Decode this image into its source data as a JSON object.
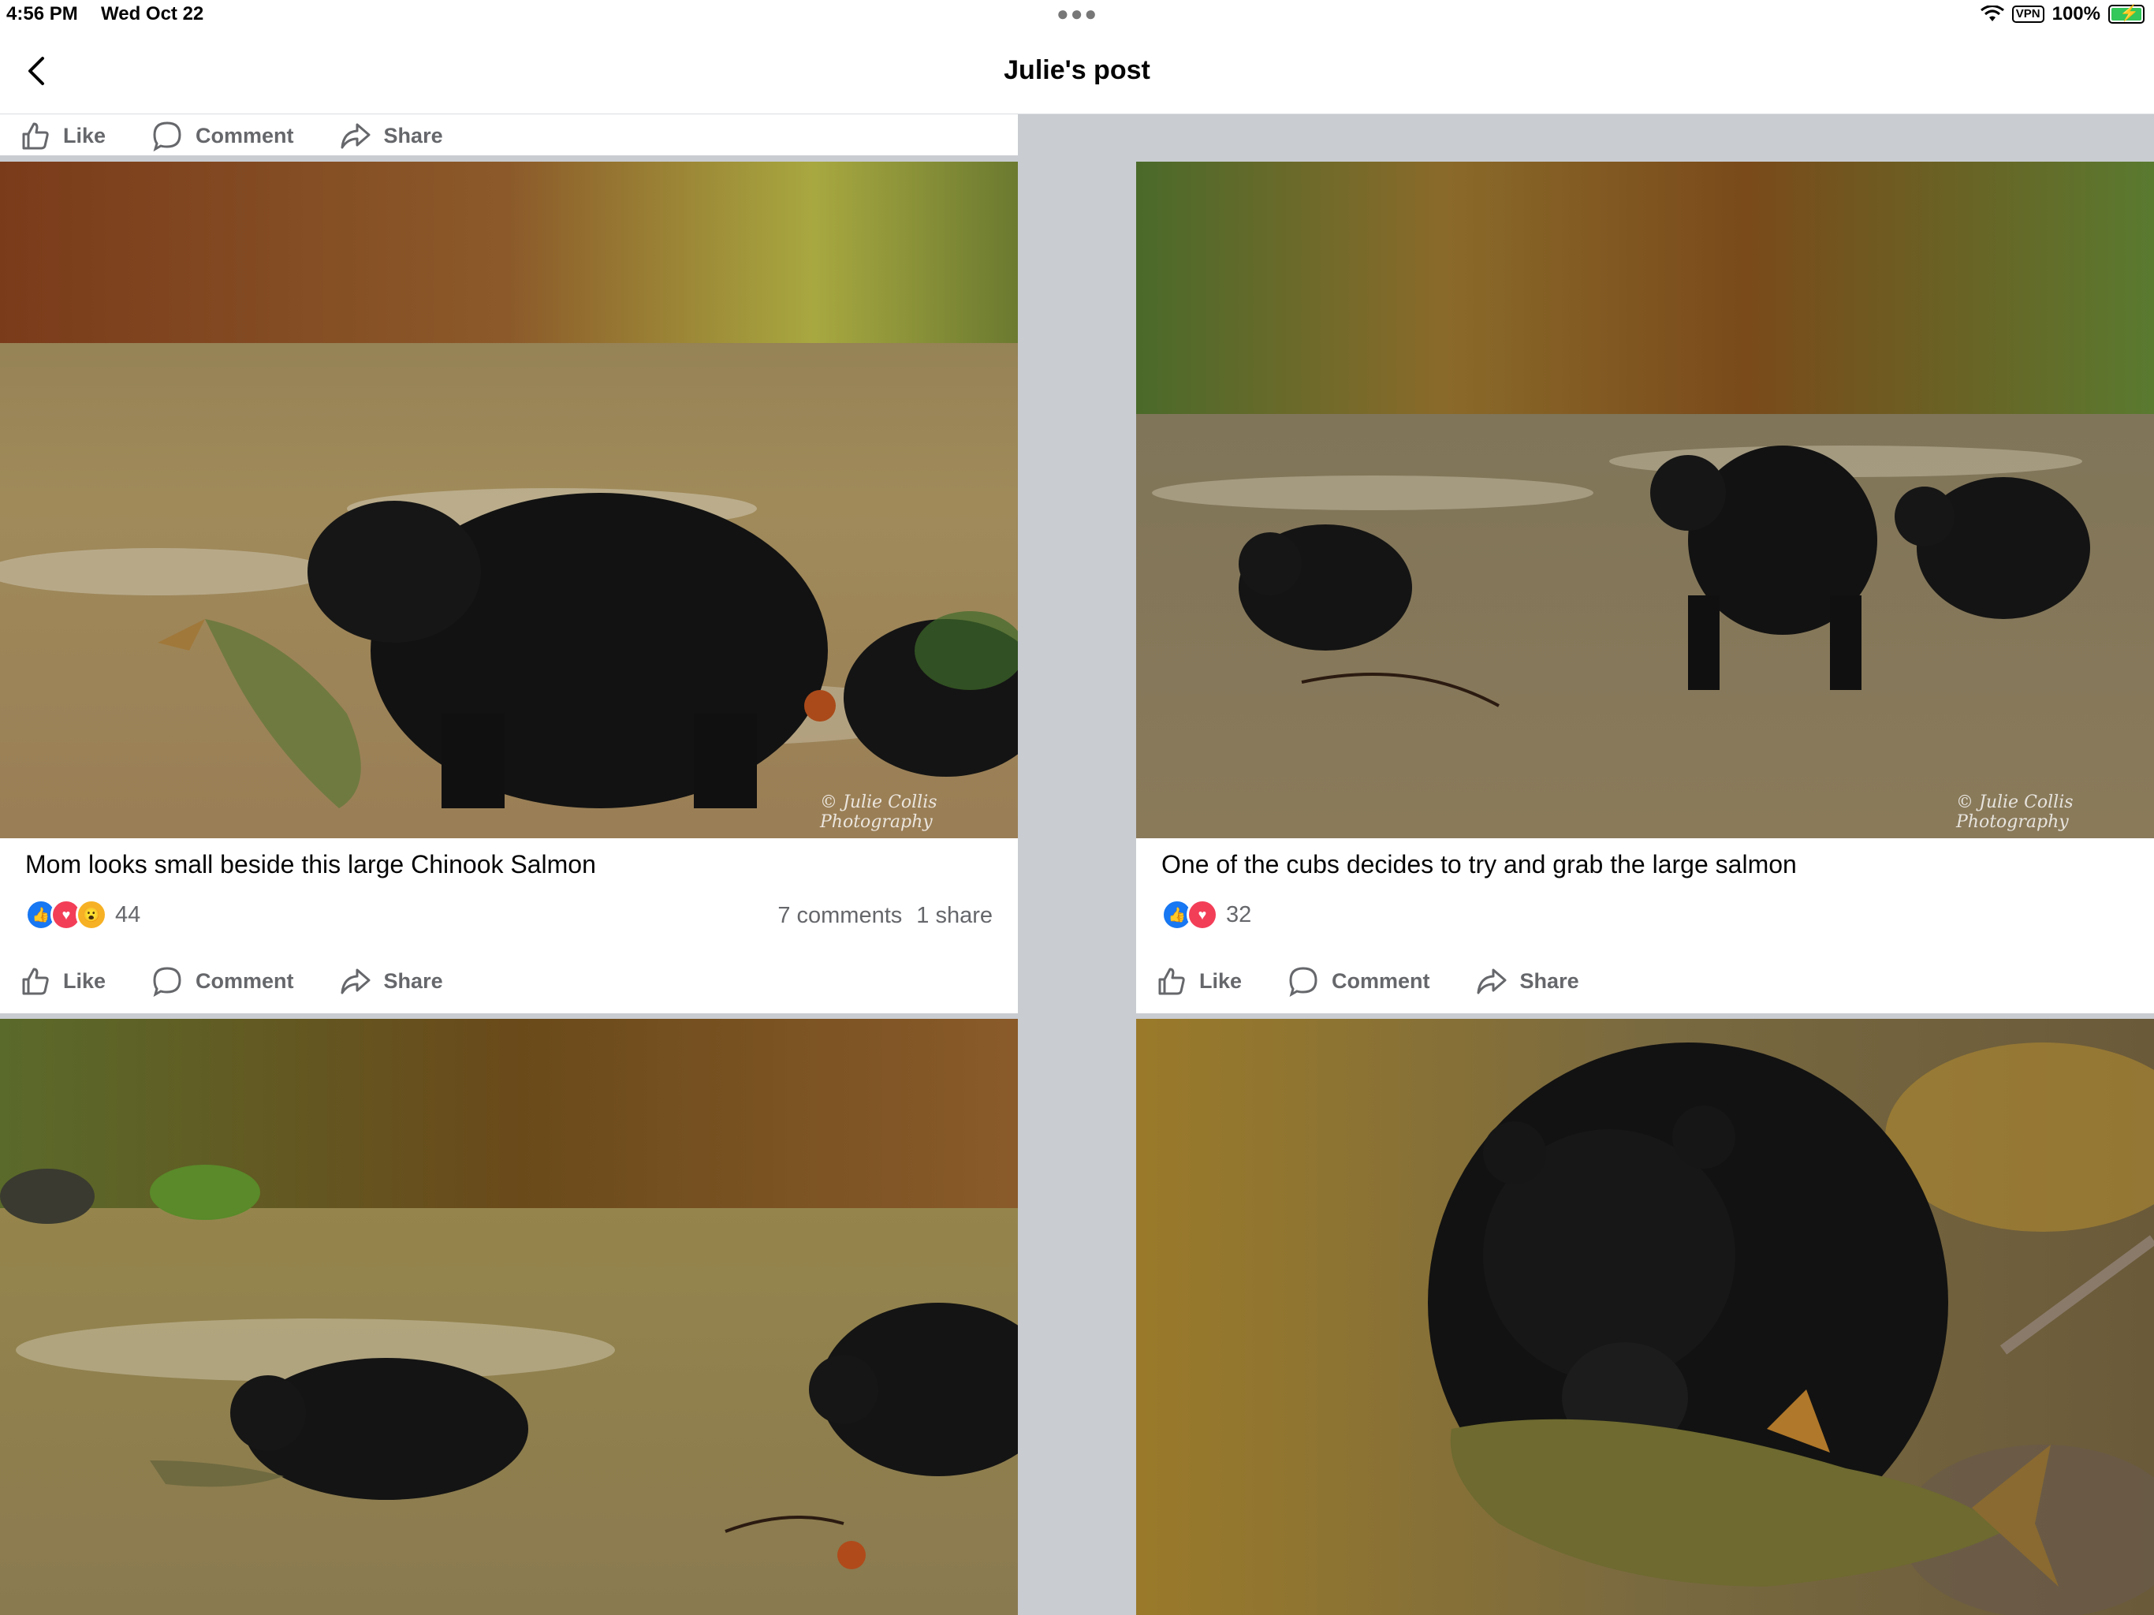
{
  "status": {
    "time": "4:56 PM",
    "date": "Wed Oct 22",
    "vpn": "VPN",
    "battery": "100%"
  },
  "nav": {
    "title": "Julie's post",
    "back_icon": "chevron-left-icon"
  },
  "actions": {
    "like": "Like",
    "comment": "Comment",
    "share": "Share"
  },
  "posts": [
    {
      "caption": "Mom looks small beside this large Chinook Salmon",
      "reactions": [
        "like",
        "love",
        "wow"
      ],
      "reaction_count": "44",
      "comments": "7 comments",
      "shares": "1 share",
      "watermark": "© Julie Collis Photography"
    },
    {
      "caption": "One of the cubs decides to try and grab the large salmon",
      "reactions": [
        "like",
        "love"
      ],
      "reaction_count": "32",
      "watermark": "© Julie Collis Photography"
    }
  ],
  "colors": {
    "accent": "#1877f2",
    "love": "#f33e58",
    "wow": "#f7b125",
    "divider": "#c9ccd1",
    "secondary_text": "#65676b"
  }
}
